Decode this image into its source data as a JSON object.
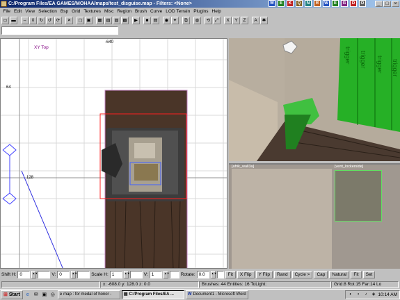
{
  "window": {
    "title": "C:/Program Files/EA GAMES/MOHAA/maps/test_disguise.map - Filters: <None>",
    "tray_icons": [
      "W",
      "E",
      "K",
      "Q",
      "N",
      "R",
      "W",
      "E",
      "G",
      "D",
      "O"
    ]
  },
  "menu": [
    "File",
    "Edit",
    "View",
    "Selection",
    "Bsp",
    "Grid",
    "Textures",
    "Misc",
    "Region",
    "Brush",
    "Curve",
    "LOD Terrain",
    "Plugins",
    "Help"
  ],
  "xy_view": {
    "label": "XY Top",
    "coord_top": "-640",
    "coord_left1": "64",
    "coord_left2": "128"
  },
  "texture_view": {
    "tex1": "[afrik_wall3a]",
    "tex2": "[vent_lockerside]"
  },
  "camera": {
    "trigger_texts": [
      "trigger",
      "trigger",
      "trigger",
      "trigger"
    ]
  },
  "surface": {
    "shift_h_label": "Shift H:",
    "shift_h": "0",
    "shift_v_label": "V:",
    "shift_v": "0",
    "scale_h_label": "Scale H:",
    "scale_h": "1",
    "scale_v_label": "V:",
    "scale_v": "1",
    "rotate_label": "Rotate:",
    "rotate": "0.0",
    "buttons": [
      "Fit",
      "X Flip",
      "Y Flip",
      "Rand",
      "Cycle >",
      "Cap",
      "Natural",
      "Fit",
      "Set"
    ]
  },
  "status": {
    "coords": "x: -608.0  y: 128.0  z: 0.0",
    "counts": "Brushes: 44 Entities: 16 ToLight: ",
    "grid": "Grid:8 Rot:15 Far:14 Lo"
  },
  "taskbar": {
    "start": "Start",
    "tasks": [
      "map : for medal of honor -",
      "C:/Program Files/EA ...",
      "Document1 - Microsoft Word"
    ],
    "clock": "10:14 AM"
  }
}
